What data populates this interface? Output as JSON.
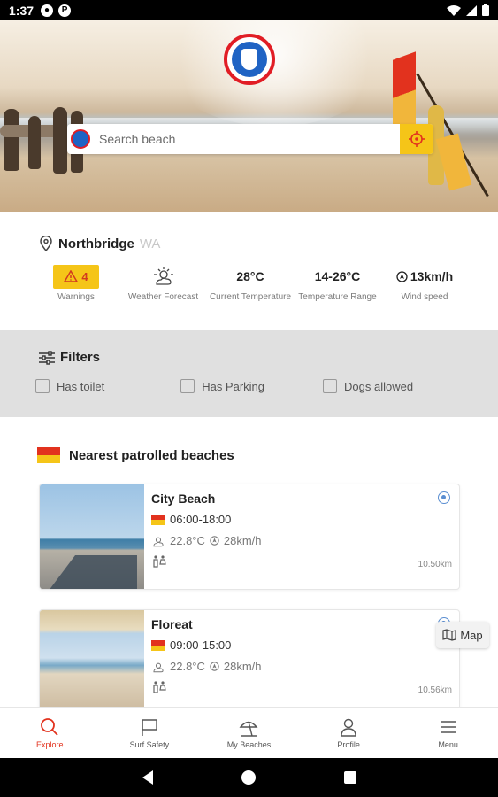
{
  "status_bar": {
    "time": "1:37"
  },
  "search": {
    "placeholder": "Search beach"
  },
  "location": {
    "city": "Northbridge",
    "state": "WA"
  },
  "stats": {
    "warnings_count": "4",
    "warnings_label": "Warnings",
    "forecast_label": "Weather Forecast",
    "current_temp": "28°C",
    "current_temp_label": "Current Temperature",
    "temp_range": "14-26°C",
    "temp_range_label": "Temperature Range",
    "wind_speed": "13km/h",
    "wind_speed_label": "Wind speed"
  },
  "filters": {
    "title": "Filters",
    "options": [
      "Has toilet",
      "Has Parking",
      "Dogs allowed"
    ]
  },
  "nearest": {
    "title": "Nearest patrolled beaches",
    "beaches": [
      {
        "name": "City Beach",
        "hours": "06:00-18:00",
        "temp": "22.8°C",
        "wind": "28km/h",
        "distance": "10.50km"
      },
      {
        "name": "Floreat",
        "hours": "09:00-15:00",
        "temp": "22.8°C",
        "wind": "28km/h",
        "distance": "10.56km"
      }
    ]
  },
  "map_button": {
    "label": "Map"
  },
  "bottom_nav": [
    {
      "label": "Explore",
      "icon": "search-icon"
    },
    {
      "label": "Surf Safety",
      "icon": "flag-icon"
    },
    {
      "label": "My Beaches",
      "icon": "umbrella-icon"
    },
    {
      "label": "Profile",
      "icon": "person-icon"
    },
    {
      "label": "Menu",
      "icon": "menu-icon"
    }
  ],
  "colors": {
    "accent_red": "#e2321e",
    "accent_yellow": "#f5c518",
    "filter_bg": "#e0e0e0"
  }
}
